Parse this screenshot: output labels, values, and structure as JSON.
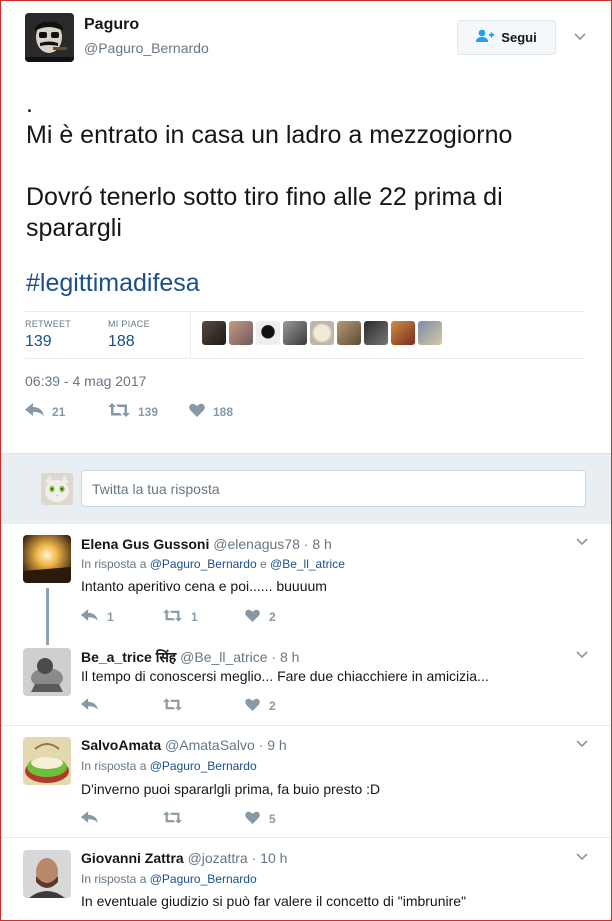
{
  "tweet": {
    "author_name": "Paguro",
    "author_handle": "@Paguro_Bernardo",
    "follow_label": "Segui",
    "text": ".\nMi è entrato in casa un ladro a mezzogiorno\n\nDovró tenerlo sotto tiro fino alle 22 prima di sparargli",
    "hashtag": "#legittimadifesa",
    "retweet_label": "RETWEET",
    "retweet_count": "139",
    "likes_label": "MI PIACE",
    "likes_count": "188",
    "timestamp": "06:39 - 4 mag 2017",
    "actions": {
      "reply": "21",
      "retweet": "139",
      "like": "188"
    }
  },
  "composer": {
    "placeholder": "Twitta la tua risposta"
  },
  "replies": [
    {
      "name": "Elena Gus Gussoni",
      "handle": "@elenagus78",
      "dot": "·",
      "time": "8 h",
      "in_reply_prefix": "In risposta a",
      "in_reply_a": "@Paguro_Bernardo",
      "in_reply_joiner": "e",
      "in_reply_b": "@Be_ll_atrice",
      "text": "Intanto aperitivo cena e poi...... buuuum",
      "reply_count": "1",
      "retweet_count": "1",
      "like_count": "2"
    },
    {
      "name": "Be_a_trice सिंह",
      "handle": "@Be_ll_atrice",
      "dot": "·",
      "time": "8 h",
      "text": "Il tempo di conoscersi meglio... Fare due chiacchiere in amicizia...",
      "reply_count": "",
      "retweet_count": "",
      "like_count": "2"
    },
    {
      "name": "SalvoAmata",
      "handle": "@AmataSalvo",
      "dot": "·",
      "time": "9 h",
      "in_reply_prefix": "In risposta a",
      "in_reply_a": "@Paguro_Bernardo",
      "text": "D'inverno puoi spararlgli prima, fa buio presto :D",
      "reply_count": "",
      "retweet_count": "",
      "like_count": "5"
    },
    {
      "name": "Giovanni Zattra",
      "handle": "@jozattra",
      "dot": "·",
      "time": "10 h",
      "in_reply_prefix": "In risposta a",
      "in_reply_a": "@Paguro_Bernardo",
      "text": "In eventuale giudizio si può far valere il concetto di \"imbrunire\""
    }
  ],
  "colors": {
    "link": "#1b4f8c",
    "muted": "#657786",
    "icon": "#8899a6",
    "band": "#e8eef2",
    "frame": "#c9302c"
  },
  "icons": {
    "follow": "add-user-icon",
    "caret": "chevron-down-icon",
    "reply": "reply-icon",
    "retweet": "retweet-icon",
    "like": "heart-icon"
  }
}
